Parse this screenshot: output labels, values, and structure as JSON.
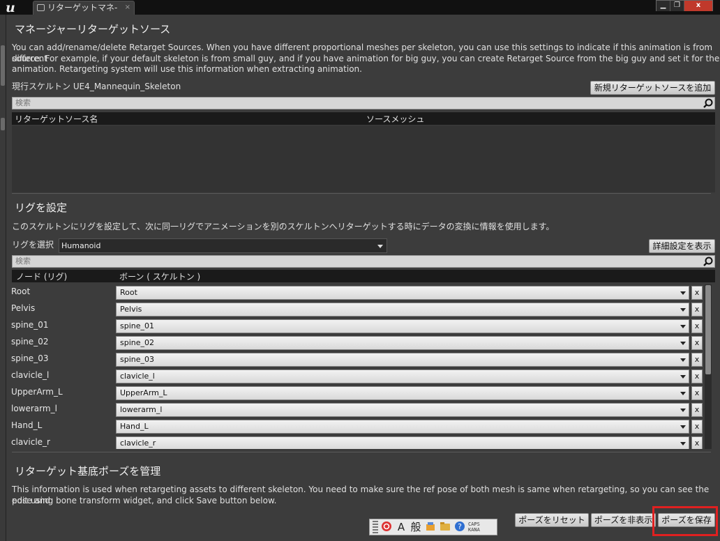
{
  "window": {
    "tab_title": "リターゲットマネ-",
    "tab_close": "×",
    "minimize": "▁",
    "restore": "❐",
    "close": "x"
  },
  "retarget_source": {
    "title": "マネージャーリターゲットソース",
    "description_1": "You can add/rename/delete Retarget Sources. When you have different proportional meshes per skeleton, you can use this settings to indicate if this animation is from different",
    "description_2": "source. For example, if your default skeleton is from small guy, and if you have animation for big guy, you can create Retarget Source from the big guy and set it for the",
    "description_3": "animation. Retargeting system will use this information when extracting animation.",
    "current_skeleton_label": "現行スケルトン UE4_Mannequin_Skeleton",
    "add_button": "新規リターゲットソースを追加",
    "search_placeholder": "検索",
    "columns": [
      "リターゲットソース名",
      "ソースメッシュ"
    ]
  },
  "rig": {
    "title": "リグを設定",
    "description": "このスケルトンにリグを設定して、次に同一リグでアニメーションを別のスケルトンへリターゲットする時にデータの変換に情報を使用します。",
    "select_label": "リグを選択",
    "selected_rig": "Humanoid",
    "advanced_button": "詳細設定を表示",
    "search_placeholder": "検索",
    "columns": [
      "ノード (リグ)",
      "ボーン ( スケルトン )"
    ],
    "remove_label": "x",
    "rows": [
      {
        "node": "Root",
        "bone": "Root"
      },
      {
        "node": "Pelvis",
        "bone": "Pelvis"
      },
      {
        "node": "spine_01",
        "bone": "spine_01"
      },
      {
        "node": "spine_02",
        "bone": "spine_02"
      },
      {
        "node": "spine_03",
        "bone": "spine_03"
      },
      {
        "node": "clavicle_l",
        "bone": "clavicle_l"
      },
      {
        "node": "UpperArm_L",
        "bone": "UpperArm_L"
      },
      {
        "node": "lowerarm_l",
        "bone": "lowerarm_l"
      },
      {
        "node": "Hand_L",
        "bone": "Hand_L"
      },
      {
        "node": "clavicle_r",
        "bone": "clavicle_r"
      }
    ]
  },
  "base_pose": {
    "title": "リターゲット基底ポーズを管理",
    "description_1": "This information is used when retargeting assets to different skeleton. You need to make sure the ref pose of both mesh is same when retargeting, so you can see the pose and",
    "description_2": "edit using bone transform widget, and click Save button below.",
    "reset_button": "ポーズをリセット",
    "hide_button": "ポーズを非表示",
    "save_button": "ポーズを保存"
  },
  "ime_bar": {
    "mode": "A",
    "general": "般",
    "help": "?",
    "caps": "CAPS",
    "kana": "KANA"
  },
  "colors": {
    "highlight": "#e02020",
    "panel": "#3c3c3c",
    "header": "#1a1a1a"
  }
}
